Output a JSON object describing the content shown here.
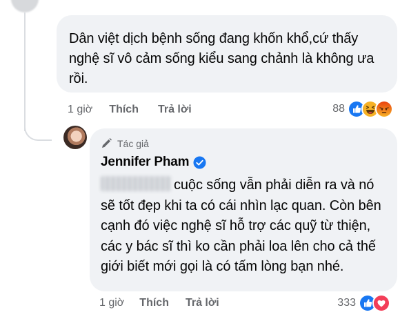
{
  "comment": {
    "text": "Dân việt dịch bệnh sống đang  khốn khổ,cứ thấy nghệ sĩ vô cảm sống kiểu sang chảnh là không ưa rồi.",
    "time": "1 giờ",
    "like_label": "Thích",
    "reply_label": "Trả lời",
    "reaction_count": "88",
    "reactions": [
      "like-icon",
      "haha-icon",
      "angry-icon"
    ]
  },
  "reply": {
    "author_badge": "Tác giả",
    "author_name": "Jennifer Pham",
    "text": "cuộc sống vẫn phải diễn ra và nó sẽ tốt đẹp khi ta có cái nhìn lạc quan. Còn bên cạnh đó việc nghệ sĩ hỗ trợ các quỹ từ thiện, các y bác sĩ thì ko cần phải loa lên cho cả thế giới biết mới gọi là có tấm lòng bạn nhé.",
    "time": "1 giờ",
    "like_label": "Thích",
    "reply_label": "Trả lời",
    "reaction_count": "333",
    "reactions": [
      "like-icon",
      "love-icon"
    ]
  },
  "colors": {
    "bubble": "#f0f2f5",
    "meta_text": "#65676b",
    "like_blue": "#1877f2",
    "love_red": "#f33e58",
    "haha_yellow": "#f7b125",
    "angry_orange": "#e9710f"
  }
}
